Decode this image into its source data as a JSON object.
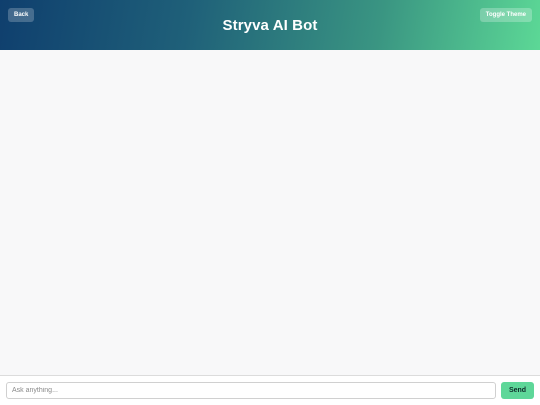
{
  "header": {
    "title": "Stryva AI Bot",
    "back_label": "Back",
    "toggle_theme_label": "Toggle Theme"
  },
  "chat": {
    "messages": []
  },
  "composer": {
    "placeholder": "Ask anything...",
    "value": "",
    "send_label": "Send"
  },
  "colors": {
    "header_gradient_start": "#0f3f6e",
    "header_gradient_end": "#5cd896",
    "send_button": "#5ed799",
    "chat_background": "#f8f8f9"
  }
}
